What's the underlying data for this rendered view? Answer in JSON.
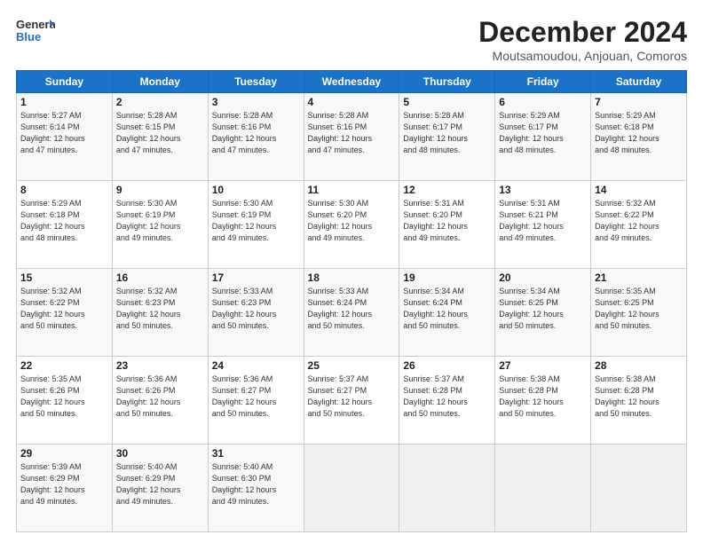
{
  "header": {
    "logo_line1": "General",
    "logo_line2": "Blue",
    "title": "December 2024",
    "subtitle": "Moutsamoudou, Anjouan, Comoros"
  },
  "calendar": {
    "headers": [
      "Sunday",
      "Monday",
      "Tuesday",
      "Wednesday",
      "Thursday",
      "Friday",
      "Saturday"
    ],
    "weeks": [
      [
        {
          "day": "1",
          "info": "Sunrise: 5:27 AM\nSunset: 6:14 PM\nDaylight: 12 hours\nand 47 minutes."
        },
        {
          "day": "2",
          "info": "Sunrise: 5:28 AM\nSunset: 6:15 PM\nDaylight: 12 hours\nand 47 minutes."
        },
        {
          "day": "3",
          "info": "Sunrise: 5:28 AM\nSunset: 6:16 PM\nDaylight: 12 hours\nand 47 minutes."
        },
        {
          "day": "4",
          "info": "Sunrise: 5:28 AM\nSunset: 6:16 PM\nDaylight: 12 hours\nand 47 minutes."
        },
        {
          "day": "5",
          "info": "Sunrise: 5:28 AM\nSunset: 6:17 PM\nDaylight: 12 hours\nand 48 minutes."
        },
        {
          "day": "6",
          "info": "Sunrise: 5:29 AM\nSunset: 6:17 PM\nDaylight: 12 hours\nand 48 minutes."
        },
        {
          "day": "7",
          "info": "Sunrise: 5:29 AM\nSunset: 6:18 PM\nDaylight: 12 hours\nand 48 minutes."
        }
      ],
      [
        {
          "day": "8",
          "info": "Sunrise: 5:29 AM\nSunset: 6:18 PM\nDaylight: 12 hours\nand 48 minutes."
        },
        {
          "day": "9",
          "info": "Sunrise: 5:30 AM\nSunset: 6:19 PM\nDaylight: 12 hours\nand 49 minutes."
        },
        {
          "day": "10",
          "info": "Sunrise: 5:30 AM\nSunset: 6:19 PM\nDaylight: 12 hours\nand 49 minutes."
        },
        {
          "day": "11",
          "info": "Sunrise: 5:30 AM\nSunset: 6:20 PM\nDaylight: 12 hours\nand 49 minutes."
        },
        {
          "day": "12",
          "info": "Sunrise: 5:31 AM\nSunset: 6:20 PM\nDaylight: 12 hours\nand 49 minutes."
        },
        {
          "day": "13",
          "info": "Sunrise: 5:31 AM\nSunset: 6:21 PM\nDaylight: 12 hours\nand 49 minutes."
        },
        {
          "day": "14",
          "info": "Sunrise: 5:32 AM\nSunset: 6:22 PM\nDaylight: 12 hours\nand 49 minutes."
        }
      ],
      [
        {
          "day": "15",
          "info": "Sunrise: 5:32 AM\nSunset: 6:22 PM\nDaylight: 12 hours\nand 50 minutes."
        },
        {
          "day": "16",
          "info": "Sunrise: 5:32 AM\nSunset: 6:23 PM\nDaylight: 12 hours\nand 50 minutes."
        },
        {
          "day": "17",
          "info": "Sunrise: 5:33 AM\nSunset: 6:23 PM\nDaylight: 12 hours\nand 50 minutes."
        },
        {
          "day": "18",
          "info": "Sunrise: 5:33 AM\nSunset: 6:24 PM\nDaylight: 12 hours\nand 50 minutes."
        },
        {
          "day": "19",
          "info": "Sunrise: 5:34 AM\nSunset: 6:24 PM\nDaylight: 12 hours\nand 50 minutes."
        },
        {
          "day": "20",
          "info": "Sunrise: 5:34 AM\nSunset: 6:25 PM\nDaylight: 12 hours\nand 50 minutes."
        },
        {
          "day": "21",
          "info": "Sunrise: 5:35 AM\nSunset: 6:25 PM\nDaylight: 12 hours\nand 50 minutes."
        }
      ],
      [
        {
          "day": "22",
          "info": "Sunrise: 5:35 AM\nSunset: 6:26 PM\nDaylight: 12 hours\nand 50 minutes."
        },
        {
          "day": "23",
          "info": "Sunrise: 5:36 AM\nSunset: 6:26 PM\nDaylight: 12 hours\nand 50 minutes."
        },
        {
          "day": "24",
          "info": "Sunrise: 5:36 AM\nSunset: 6:27 PM\nDaylight: 12 hours\nand 50 minutes."
        },
        {
          "day": "25",
          "info": "Sunrise: 5:37 AM\nSunset: 6:27 PM\nDaylight: 12 hours\nand 50 minutes."
        },
        {
          "day": "26",
          "info": "Sunrise: 5:37 AM\nSunset: 6:28 PM\nDaylight: 12 hours\nand 50 minutes."
        },
        {
          "day": "27",
          "info": "Sunrise: 5:38 AM\nSunset: 6:28 PM\nDaylight: 12 hours\nand 50 minutes."
        },
        {
          "day": "28",
          "info": "Sunrise: 5:38 AM\nSunset: 6:28 PM\nDaylight: 12 hours\nand 50 minutes."
        }
      ],
      [
        {
          "day": "29",
          "info": "Sunrise: 5:39 AM\nSunset: 6:29 PM\nDaylight: 12 hours\nand 49 minutes."
        },
        {
          "day": "30",
          "info": "Sunrise: 5:40 AM\nSunset: 6:29 PM\nDaylight: 12 hours\nand 49 minutes."
        },
        {
          "day": "31",
          "info": "Sunrise: 5:40 AM\nSunset: 6:30 PM\nDaylight: 12 hours\nand 49 minutes."
        },
        {
          "day": "",
          "info": ""
        },
        {
          "day": "",
          "info": ""
        },
        {
          "day": "",
          "info": ""
        },
        {
          "day": "",
          "info": ""
        }
      ]
    ]
  }
}
